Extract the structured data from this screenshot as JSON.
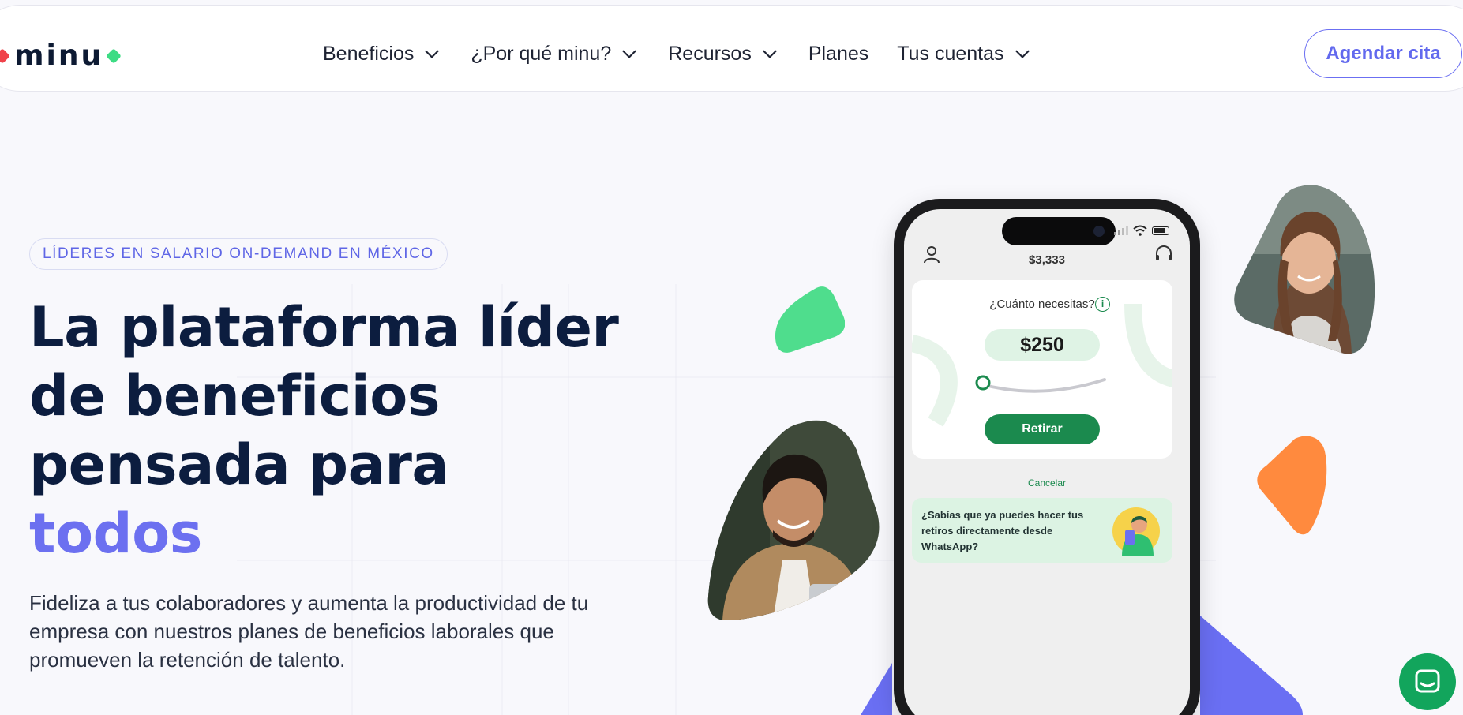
{
  "brand": {
    "name": "minu",
    "colors": {
      "red": "#f0424a",
      "green": "#3ddc84",
      "accent": "#6c70f0",
      "navy": "#0c1d3f"
    }
  },
  "nav": {
    "items": [
      {
        "label": "Beneficios",
        "dropdown": true
      },
      {
        "label": "¿Por qué minu?",
        "dropdown": true
      },
      {
        "label": "Recursos",
        "dropdown": true
      },
      {
        "label": "Planes",
        "dropdown": false
      },
      {
        "label": "Tus cuentas",
        "dropdown": true
      }
    ],
    "cta": "Agendar cita"
  },
  "hero": {
    "badge": "LÍDERES EN SALARIO ON-DEMAND EN MÉXICO",
    "headline_lines": [
      "La plataforma líder",
      "de beneficios",
      "pensada para"
    ],
    "headline_accent": "todos",
    "subtext": "Fideliza a tus colaboradores y aumenta la productividad de tu empresa con nuestros planes de beneficios laborales que promueven la retención de talento."
  },
  "phone": {
    "balance": "$3,333",
    "question": "¿Cuánto necesitas?",
    "amount": "$250",
    "withdraw_button": "Retirar",
    "cancel": "Cancelar",
    "tip": "¿Sabías que ya puedes hacer tus retiros directamente desde WhatsApp?"
  },
  "icons": {
    "chevron": "chevron-down-icon",
    "user": "user-icon",
    "support": "headset-icon",
    "info": "info-icon",
    "chat": "chat-icon"
  }
}
